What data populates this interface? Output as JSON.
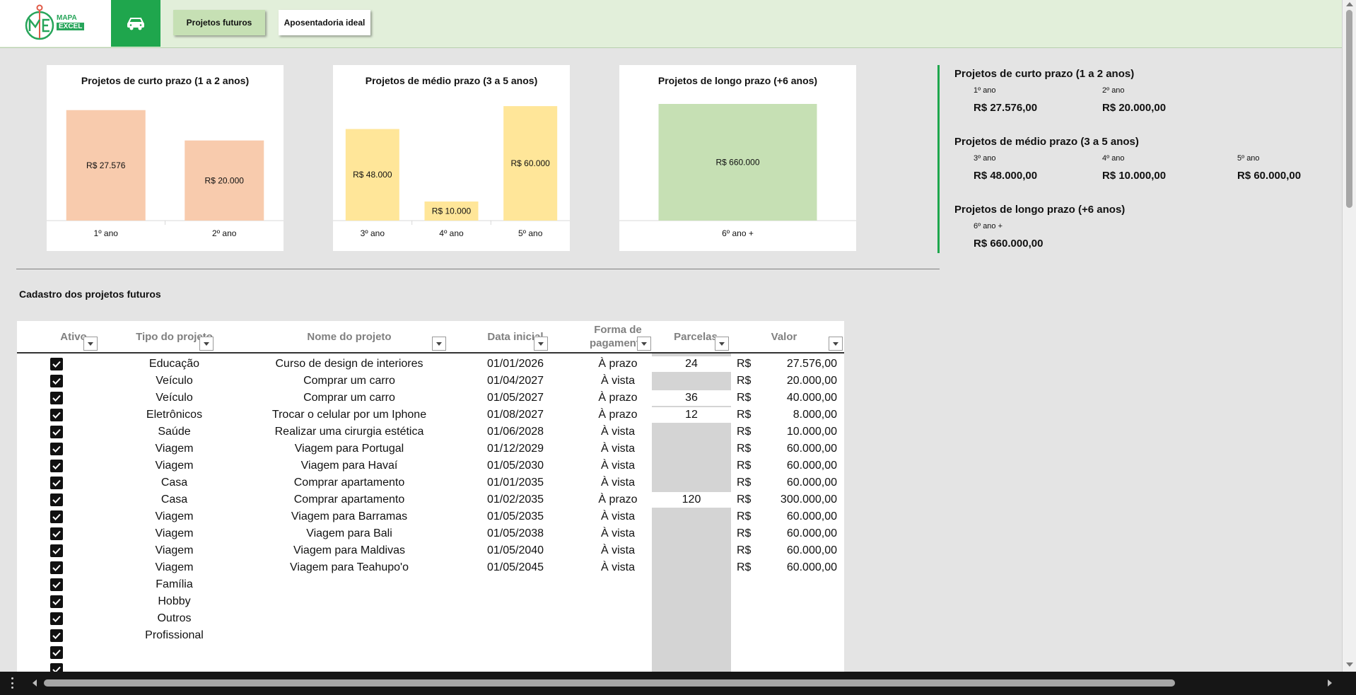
{
  "brand": {
    "line1": "MAPA",
    "line2": "EXCEL"
  },
  "colors": {
    "accent": "#1fa64d",
    "short_bar": "#f8cbad",
    "mid_bar": "#ffe699",
    "long_bar": "#c6e0b4"
  },
  "nav": {
    "car_icon": "car-icon",
    "tabs": [
      {
        "label": "Projetos futuros",
        "active": true
      },
      {
        "label": "Aposentadoria ideal",
        "active": false
      }
    ]
  },
  "chart_data": [
    {
      "type": "bar",
      "title": "Projetos de curto prazo (1 a 2 anos)",
      "categories": [
        "1º ano",
        "2º ano"
      ],
      "values": [
        27576,
        20000
      ],
      "labels": [
        "R$ 27.576",
        "R$ 20.000"
      ],
      "color": "#f8cbad"
    },
    {
      "type": "bar",
      "title": "Projetos de médio prazo (3 a 5 anos)",
      "categories": [
        "3º ano",
        "4º ano",
        "5º ano"
      ],
      "values": [
        48000,
        10000,
        60000
      ],
      "labels": [
        "R$ 48.000",
        "R$ 10.000",
        "R$ 60.000"
      ],
      "color": "#ffe699"
    },
    {
      "type": "bar",
      "title": "Projetos de longo prazo (+6 anos)",
      "categories": [
        "6º ano +"
      ],
      "values": [
        660000
      ],
      "labels": [
        "R$ 660.000"
      ],
      "color": "#c6e0b4"
    }
  ],
  "summary": [
    {
      "title": "Projetos de curto prazo (1 a 2 anos)",
      "items": [
        {
          "label": "1º ano",
          "value": "R$ 27.576,00"
        },
        {
          "label": "2º ano",
          "value": "R$ 20.000,00"
        }
      ]
    },
    {
      "title": "Projetos de médio prazo (3 a 5 anos)",
      "items": [
        {
          "label": "3º ano",
          "value": "R$ 48.000,00"
        },
        {
          "label": "4º ano",
          "value": "R$ 10.000,00"
        },
        {
          "label": "5º ano",
          "value": "R$ 60.000,00"
        }
      ]
    },
    {
      "title": "Projetos de longo prazo (+6 anos)",
      "items": [
        {
          "label": "6º ano +",
          "value": "R$ 660.000,00"
        }
      ]
    }
  ],
  "section_title": "Cadastro dos projetos futuros",
  "table": {
    "headers": {
      "ativo": "Ativo",
      "tipo": "Tipo do projeto",
      "nome": "Nome do projeto",
      "data": "Data inicial",
      "forma_1": "Forma de",
      "forma_2": "pagamento",
      "parcelas": "Parcelas",
      "valor": "Valor"
    },
    "currency": "R$",
    "rows": [
      {
        "ativo": true,
        "tipo": "Educação",
        "nome": "Curso de design de interiores",
        "data": "01/01/2026",
        "forma": "À prazo",
        "parcelas": "24",
        "valor": "27.576,00"
      },
      {
        "ativo": true,
        "tipo": "Veículo",
        "nome": "Comprar um carro",
        "data": "01/04/2027",
        "forma": "À vista",
        "parcelas": "",
        "valor": "20.000,00"
      },
      {
        "ativo": true,
        "tipo": "Veículo",
        "nome": "Comprar um carro",
        "data": "01/05/2027",
        "forma": "À prazo",
        "parcelas": "36",
        "valor": "40.000,00"
      },
      {
        "ativo": true,
        "tipo": "Eletrônicos",
        "nome": "Trocar o celular por um Iphone",
        "data": "01/08/2027",
        "forma": "À prazo",
        "parcelas": "12",
        "valor": "8.000,00"
      },
      {
        "ativo": true,
        "tipo": "Saúde",
        "nome": "Realizar uma cirurgia estética",
        "data": "01/06/2028",
        "forma": "À vista",
        "parcelas": "",
        "valor": "10.000,00"
      },
      {
        "ativo": true,
        "tipo": "Viagem",
        "nome": "Viagem para Portugal",
        "data": "01/12/2029",
        "forma": "À vista",
        "parcelas": "",
        "valor": "60.000,00"
      },
      {
        "ativo": true,
        "tipo": "Viagem",
        "nome": "Viagem para Havaí",
        "data": "01/05/2030",
        "forma": "À vista",
        "parcelas": "",
        "valor": "60.000,00"
      },
      {
        "ativo": true,
        "tipo": "Casa",
        "nome": "Comprar apartamento",
        "data": "01/01/2035",
        "forma": "À vista",
        "parcelas": "",
        "valor": "60.000,00"
      },
      {
        "ativo": true,
        "tipo": "Casa",
        "nome": "Comprar apartamento",
        "data": "01/02/2035",
        "forma": "À prazo",
        "parcelas": "120",
        "valor": "300.000,00"
      },
      {
        "ativo": true,
        "tipo": "Viagem",
        "nome": "Viagem para Barramas",
        "data": "01/05/2035",
        "forma": "À vista",
        "parcelas": "",
        "valor": "60.000,00"
      },
      {
        "ativo": true,
        "tipo": "Viagem",
        "nome": "Viagem para Bali",
        "data": "01/05/2038",
        "forma": "À vista",
        "parcelas": "",
        "valor": "60.000,00"
      },
      {
        "ativo": true,
        "tipo": "Viagem",
        "nome": "Viagem para Maldivas",
        "data": "01/05/2040",
        "forma": "À vista",
        "parcelas": "",
        "valor": "60.000,00"
      },
      {
        "ativo": true,
        "tipo": "Viagem",
        "nome": "Viagem para Teahupo'o",
        "data": "01/05/2045",
        "forma": "À vista",
        "parcelas": "",
        "valor": "60.000,00"
      },
      {
        "ativo": true,
        "tipo": "Família",
        "nome": "",
        "data": "",
        "forma": "",
        "parcelas": "",
        "valor": ""
      },
      {
        "ativo": true,
        "tipo": "Hobby",
        "nome": "",
        "data": "",
        "forma": "",
        "parcelas": "",
        "valor": ""
      },
      {
        "ativo": true,
        "tipo": "Outros",
        "nome": "",
        "data": "",
        "forma": "",
        "parcelas": "",
        "valor": ""
      },
      {
        "ativo": true,
        "tipo": "Profissional",
        "nome": "",
        "data": "",
        "forma": "",
        "parcelas": "",
        "valor": ""
      },
      {
        "ativo": true,
        "tipo": "",
        "nome": "",
        "data": "",
        "forma": "",
        "parcelas": "",
        "valor": ""
      },
      {
        "ativo": true,
        "tipo": "",
        "nome": "",
        "data": "",
        "forma": "",
        "parcelas": "",
        "valor": ""
      }
    ]
  }
}
